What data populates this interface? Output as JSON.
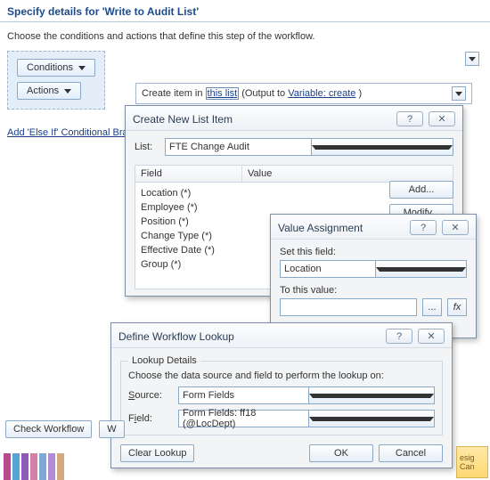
{
  "header": {
    "title": "Specify details for 'Write to Audit List'"
  },
  "subtext": "Choose the conditions and actions that define this step of the workflow.",
  "buttons": {
    "conditions": "Conditions",
    "actions": "Actions",
    "check_workflow": "Check Workflow",
    "w_truncated": "W",
    "add_else": "Add 'Else If' Conditional Bran"
  },
  "rule": {
    "prefix": "Create item in ",
    "link": "this list",
    "mid": " (Output to ",
    "var": "Variable: create",
    "suffix": " )"
  },
  "dlg_create": {
    "title": "Create New List Item",
    "list_label": "List:",
    "list_value": "FTE Change Audit",
    "col_field": "Field",
    "col_value": "Value",
    "fields": [
      "Location (*)",
      "Employee (*)",
      "Position (*)",
      "Change Type (*)",
      "Effective Date (*)",
      "Group (*)"
    ],
    "add": "Add...",
    "modify": "Modify..."
  },
  "dlg_value": {
    "title": "Value Assignment",
    "set_field": "Set this field:",
    "field_value": "Location",
    "to_value": "To this value:",
    "input_value": ""
  },
  "dlg_lookup": {
    "title": "Define Workflow Lookup",
    "group": "Lookup Details",
    "instruction": "Choose the data source and field to perform the lookup on:",
    "source_label": "Source:",
    "source_value": "Form Fields",
    "field_label": "Field:",
    "field_label_u": "i",
    "field_value": "Form Fields: ff18 (@LocDept)",
    "clear": "Clear Lookup",
    "ok": "OK",
    "cancel": "Cancel"
  },
  "glyphs": {
    "help": "?",
    "close": "✕",
    "dots": "...",
    "fx": "fx"
  },
  "deco": {
    "line1": "esig",
    "line2": "Can"
  }
}
